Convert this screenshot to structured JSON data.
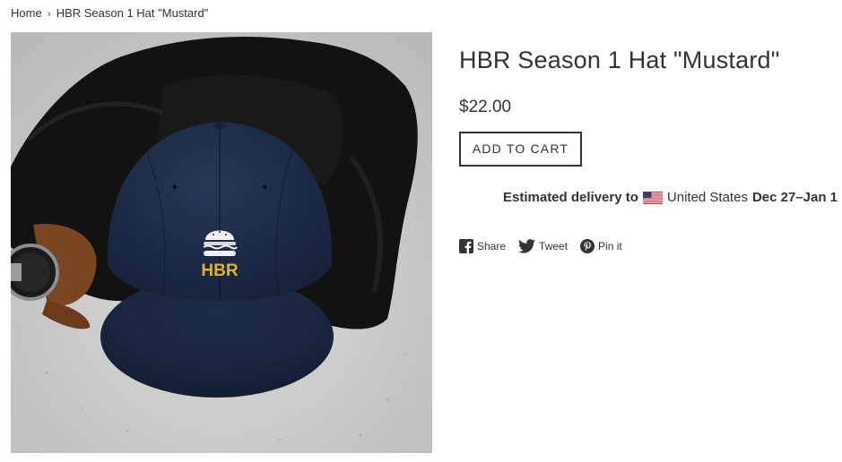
{
  "breadcrumb": {
    "home": "Home",
    "separator": "›",
    "current": "HBR Season 1 Hat \"Mustard\""
  },
  "product": {
    "title": "HBR Season 1 Hat \"Mustard\"",
    "price": "$22.00",
    "add_to_cart_label": "ADD TO CART",
    "image_logo_text": "HBR"
  },
  "delivery": {
    "prefix": "Estimated delivery to",
    "country": "United States",
    "dates": "Dec 27–Jan 1"
  },
  "social": {
    "share": "Share",
    "tweet": "Tweet",
    "pin": "Pin it"
  },
  "colors": {
    "text": "#333333",
    "hat_navy": "#1f2c44",
    "logo_yellow": "#e0b421",
    "background_concrete": "#cfcfcf"
  }
}
